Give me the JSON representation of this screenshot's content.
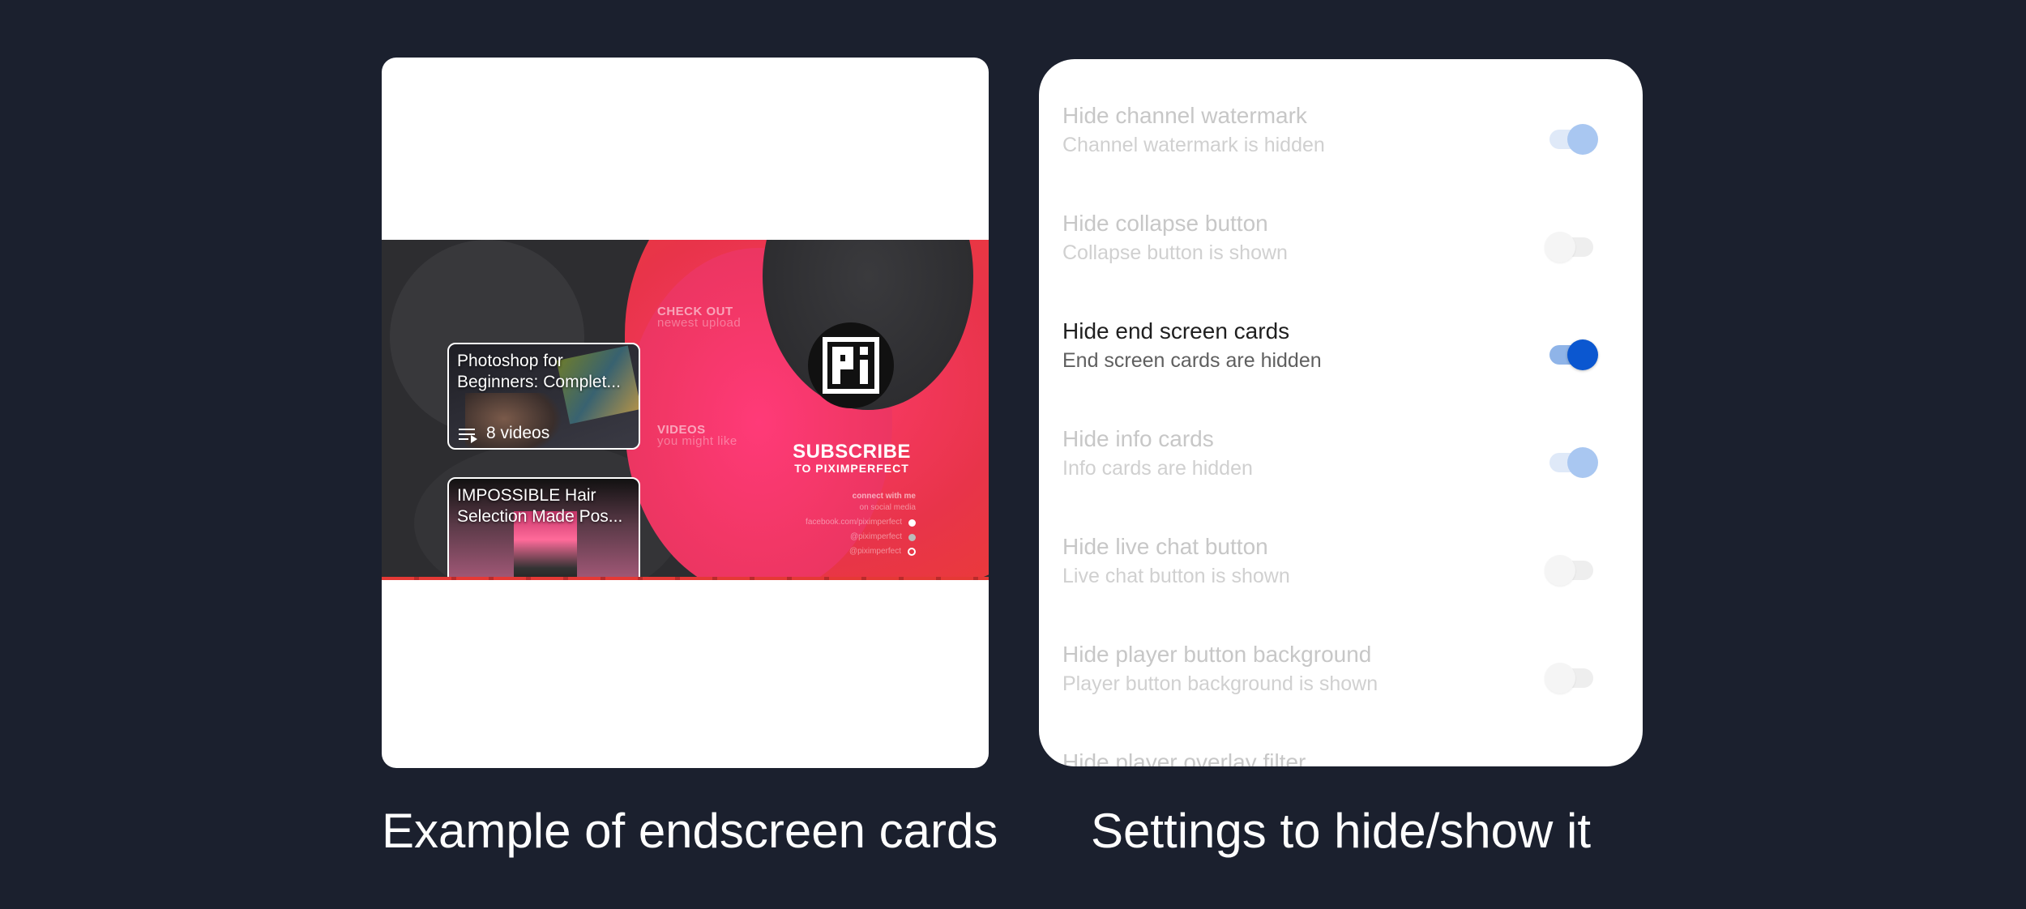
{
  "left_panel": {
    "cards": [
      {
        "title_lines": [
          "Photoshop for",
          "Beginners: Complet..."
        ],
        "footer": "8 videos",
        "footer_icon": "playlist-icon"
      },
      {
        "title_lines": [
          "IMPOSSIBLE Hair",
          "Selection Made Pos..."
        ]
      }
    ],
    "video_labels": {
      "check_out": "CHECK OUT",
      "newest_upload": "newest upload",
      "videos": "VIDEOS",
      "you_might_like": "you might like"
    },
    "subscribe": {
      "main": "SUBSCRIBE",
      "sub": "TO PIXIMPERFECT"
    },
    "social": {
      "heading": "connect with me",
      "sub": "on social media",
      "facebook": "facebook.com/piximperfect",
      "handle_1": "@piximperfect",
      "handle_2": "@piximperfect"
    },
    "caption": "Example of endscreen cards"
  },
  "settings": {
    "items": [
      {
        "title": "Hide channel watermark",
        "subtitle": "Channel watermark is hidden",
        "on": true,
        "enabled": false
      },
      {
        "title": "Hide collapse button",
        "subtitle": "Collapse button is shown",
        "on": false,
        "enabled": false
      },
      {
        "title": "Hide end screen cards",
        "subtitle": "End screen cards are hidden",
        "on": true,
        "enabled": true
      },
      {
        "title": "Hide info cards",
        "subtitle": "Info cards are hidden",
        "on": true,
        "enabled": false
      },
      {
        "title": "Hide live chat button",
        "subtitle": "Live chat button is shown",
        "on": false,
        "enabled": false
      },
      {
        "title": "Hide player button background",
        "subtitle": "Player button background is shown",
        "on": false,
        "enabled": false
      },
      {
        "title": "Hide player overlay filter",
        "subtitle": "",
        "on": false,
        "enabled": false
      }
    ],
    "caption": "Settings to hide/show it"
  },
  "colors": {
    "background": "#1b202e",
    "toggle_on": "#0b57d0",
    "toggle_on_track": "#8fb4e8",
    "video_red": "#e93a38",
    "video_pink": "#f23766"
  }
}
